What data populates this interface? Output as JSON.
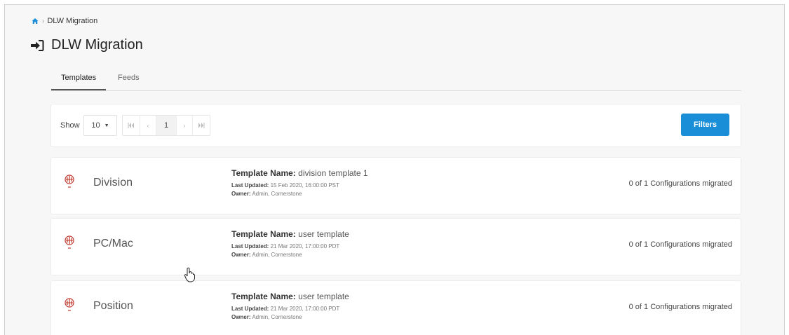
{
  "breadcrumb": {
    "home_icon": "home-icon",
    "separator": "›",
    "current": "DLW Migration"
  },
  "page": {
    "title_icon": "login-icon",
    "title": "DLW Migration"
  },
  "tabs": [
    {
      "label": "Templates",
      "active": true
    },
    {
      "label": "Feeds",
      "active": false
    }
  ],
  "toolbar": {
    "show_label": "Show",
    "page_size": "10",
    "pager": {
      "first": "|◀◀",
      "prev": "‹",
      "current": "1",
      "next": "›",
      "last": "▶▶|"
    },
    "filters_label": "Filters"
  },
  "templates": [
    {
      "icon": "template-icon",
      "name": "Division",
      "template_label": "Template Name:",
      "template_name": "division template 1",
      "updated_label": "Last Updated:",
      "updated": "15 Feb 2020, 16:00:00 PST",
      "owner_label": "Owner:",
      "owner": "Admin, Cornerstone",
      "status": "0 of 1 Configurations migrated"
    },
    {
      "icon": "template-icon",
      "name": "PC/Mac",
      "template_label": "Template Name:",
      "template_name": "user template",
      "updated_label": "Last Updated:",
      "updated": "21 Mar 2020, 17:00:00 PDT",
      "owner_label": "Owner:",
      "owner": "Admin, Cornerstone",
      "status": "0 of 1 Configurations migrated"
    },
    {
      "icon": "template-icon",
      "name": "Position",
      "template_label": "Template Name:",
      "template_name": "user template",
      "updated_label": "Last Updated:",
      "updated": "21 Mar 2020, 17:00:00 PDT",
      "owner_label": "Owner:",
      "owner": "Admin, Cornerstone",
      "status": "0 of 1 Configurations migrated"
    }
  ],
  "colors": {
    "accent": "#1a8fd8",
    "icon_red": "#c0392b",
    "background": "#f7f7f8"
  }
}
